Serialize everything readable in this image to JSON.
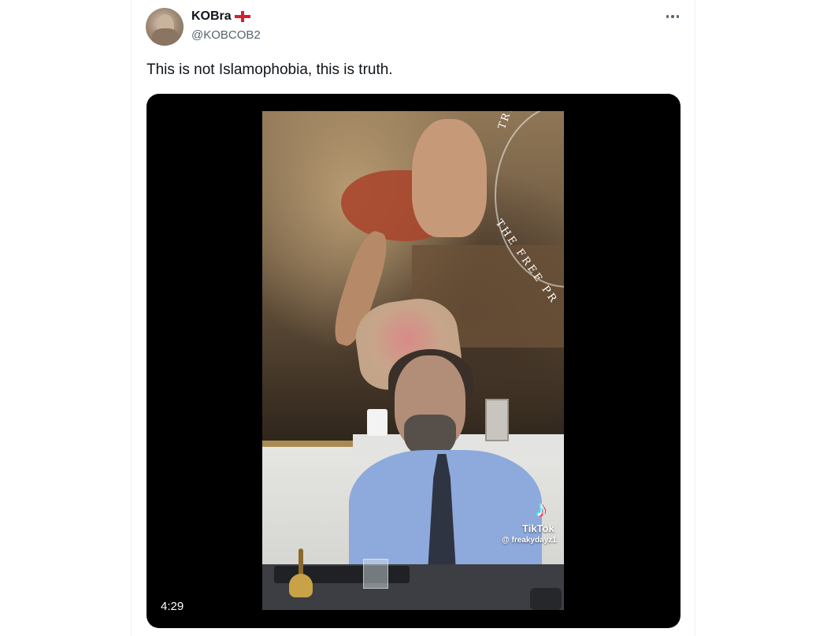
{
  "author": {
    "display_name": "KOBra",
    "handle": "@KOBCOB2",
    "flag_icon": "england-flag-icon"
  },
  "tweet": {
    "text": "This is not Islamophobia, this is truth."
  },
  "media": {
    "duration": "4:29",
    "watermark_seal_top": "TRYKKEFRIHEDS",
    "watermark_seal_bottom": "THE FREE PR",
    "tiktok_label": "TikTok",
    "tiktok_user": "@ freakydayz1"
  },
  "colors": {
    "text_primary": "#0f1419",
    "text_secondary": "#536471",
    "media_background": "#000000",
    "flag_red": "#d4202f"
  }
}
